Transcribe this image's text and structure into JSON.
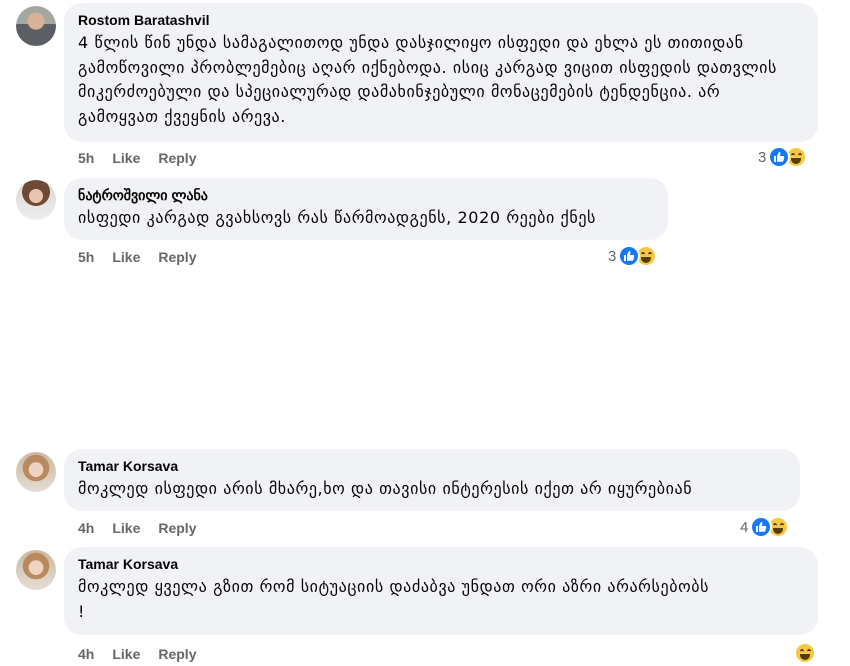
{
  "comments": [
    {
      "author": "Rostom Baratashvil",
      "text": "4 წლის წინ უნდა სამაგალითოდ უნდა დასჯილიყო ისფედი და ეხლა ეს თითიდან გამოწოვილი პრობლემებიც აღარ იქნებოდა. ისიც კარგად ვიცით ისფედის დათვლის მიკერძოებული და სპეციალურად დამახინჯებული მონაცემების ტენდენცია. არ გამოყვათ ქვეყნის არევა.",
      "time": "5h",
      "like": "Like",
      "reply": "Reply",
      "reactions": "3"
    },
    {
      "author": "ნატროშვილი ლანა",
      "text": "ისფედი კარგად გვახსოვს რას წარმოადგენს, 2020 რეები ქნეს",
      "time": "5h",
      "like": "Like",
      "reply": "Reply",
      "reactions": "3"
    },
    {
      "author": "Tamar Korsava",
      "text": "მოკლედ ისფედი არის მხარე,ხო და თავისი ინტერესის იქეთ არ იყურებიან",
      "time": "4h",
      "like": "Like",
      "reply": "Reply",
      "reactions": "4"
    },
    {
      "author": "Tamar Korsava",
      "text": "მოკლედ ყველა გზით რომ სიტუაციის დაძაბვა უნდათ ორი აზრი არარსებობს !",
      "time": "4h",
      "like": "Like",
      "reply": "Reply",
      "reactions": ""
    }
  ],
  "icons": {
    "like": "like-reaction-icon",
    "haha": "haha-reaction-icon"
  },
  "colors": {
    "bubble": "#f0f2f5",
    "meta": "#65676b",
    "like_blue": "#1877f2",
    "haha_yellow": "#f7c843"
  }
}
